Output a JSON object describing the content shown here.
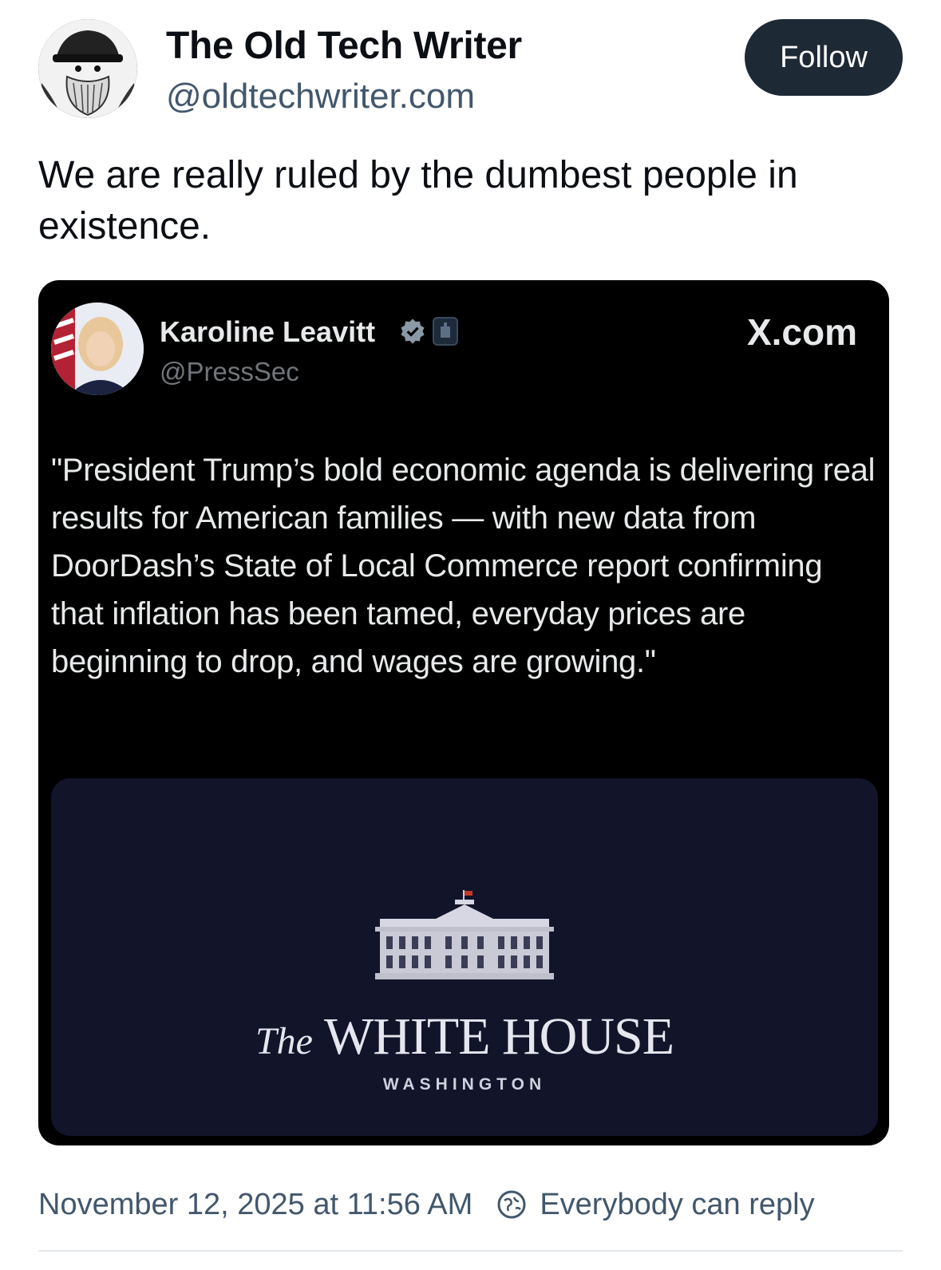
{
  "author": {
    "name": "The Old Tech Writer",
    "handle": "@oldtechwriter.com",
    "avatar_icon": "bearded-man-avatar"
  },
  "follow_label": "Follow",
  "post_text": "We are really ruled by the dumbest people in existence.",
  "embed": {
    "name": "Karoline Leavitt",
    "handle": "@PressSec",
    "site": "X.com",
    "badges": [
      "verified-badge-icon",
      "government-badge-icon"
    ],
    "quote": "\"President Trump’s bold economic agenda is delivering real results for American families — with new data from DoorDash’s State of Local Commerce report confirming that inflation has been tamed, everyday prices are beginning to drop, and wages are growing.\"",
    "card": {
      "the": "The",
      "title": "WHITE HOUSE",
      "subtitle": "WASHINGTON"
    }
  },
  "footer": {
    "timestamp": "November 12, 2025 at 11:56 AM",
    "reply_setting": "Everybody can reply"
  },
  "colors": {
    "follow_bg": "#1e2936",
    "embed_bg": "#000000",
    "card_bg": "#12142a",
    "muted_text": "#42576c"
  }
}
